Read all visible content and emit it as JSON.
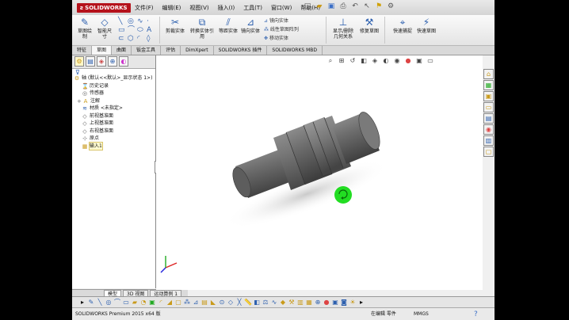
{
  "app": {
    "brand": "SOLIDWORKS"
  },
  "menu": [
    "文件(F)",
    "编辑(E)",
    "视图(V)",
    "插入(I)",
    "工具(T)",
    "窗口(W)",
    "帮助(H)"
  ],
  "quick_access": [
    "new-icon",
    "open-icon",
    "save-icon",
    "print-icon",
    "undo-icon",
    "select-icon",
    "rebuild-icon",
    "options-icon"
  ],
  "command_manager": {
    "buttons": [
      {
        "label": "草图绘制",
        "icon": "sketch-icon",
        "color": "#2c5fae"
      },
      {
        "label": "智能尺寸",
        "icon": "smart-dimension-icon",
        "color": "#2c5fae"
      },
      {
        "label": "剪裁实体",
        "icon": "trim-icon",
        "color": "#2c5fae"
      },
      {
        "label": "转换实体引用",
        "icon": "convert-entities-icon",
        "color": "#2c5fae"
      },
      {
        "label": "等距实体",
        "icon": "offset-icon",
        "color": "#2c5fae"
      },
      {
        "label": "镜向实体",
        "icon": "mirror-icon",
        "color": "#2c5fae"
      },
      {
        "label": "显示/删除几何关系",
        "icon": "relations-icon",
        "color": "#2c5fae"
      },
      {
        "label": "修复草图",
        "icon": "repair-sketch-icon",
        "color": "#2c5fae"
      },
      {
        "label": "快速捕捉",
        "icon": "quick-snap-icon",
        "color": "#2c5fae"
      },
      {
        "label": "快速草图",
        "icon": "rapid-sketch-icon",
        "color": "#2c5fae"
      }
    ],
    "list_items": [
      "镜向实体",
      "线性草图阵列",
      "移动实体"
    ]
  },
  "tabs": [
    {
      "label": "特征",
      "active": false
    },
    {
      "label": "草图",
      "active": true
    },
    {
      "label": "曲面",
      "active": false
    },
    {
      "label": "钣金工具",
      "active": false
    },
    {
      "label": "评估",
      "active": false
    },
    {
      "label": "DimXpert",
      "active": false
    },
    {
      "label": "SOLIDWORKS 插件",
      "active": false
    },
    {
      "label": "SOLIDWORKS MBD",
      "active": false
    }
  ],
  "feature_manager": {
    "tabs": [
      "feature-tree-icon",
      "property-icon",
      "config-icon",
      "dimxpert-icon",
      "display-icon"
    ],
    "tree": [
      {
        "label": "轴 (默认<<默认>_显示状态 1>)",
        "icon": "part-icon",
        "indent": 0,
        "selected": false
      },
      {
        "label": "历史记录",
        "icon": "history-icon",
        "indent": 1,
        "selected": false
      },
      {
        "label": "传感器",
        "icon": "sensor-icon",
        "indent": 1,
        "selected": false
      },
      {
        "label": "注解",
        "icon": "annotation-icon",
        "indent": 1,
        "selected": false
      },
      {
        "label": "材质 <未指定>",
        "icon": "material-icon",
        "indent": 1,
        "selected": false
      },
      {
        "label": "前视基准面",
        "icon": "plane-icon",
        "indent": 1,
        "selected": false
      },
      {
        "label": "上视基准面",
        "icon": "plane-icon",
        "indent": 1,
        "selected": false
      },
      {
        "label": "右视基准面",
        "icon": "plane-icon",
        "indent": 1,
        "selected": false
      },
      {
        "label": "原点",
        "icon": "origin-icon",
        "indent": 1,
        "selected": false
      },
      {
        "label": "输入1",
        "icon": "import-icon",
        "indent": 1,
        "selected": true
      }
    ],
    "bottom_tabs": [
      {
        "label": "模型",
        "active": true
      },
      {
        "label": "3D 视图",
        "active": false
      },
      {
        "label": "运动算例 1",
        "active": false
      }
    ]
  },
  "status": {
    "product": "SOLIDWORKS Premium 2015 x64 版",
    "mode": "在编辑 零件",
    "units": "MMGS",
    "help_icon": "help-icon"
  },
  "colors": {
    "accent": "#2c5fae",
    "part_body": "#6e6e6e",
    "cursor_marker": "#22dd22",
    "brand_red": "#b5121b",
    "selection_highlight": "#fffbd0"
  }
}
